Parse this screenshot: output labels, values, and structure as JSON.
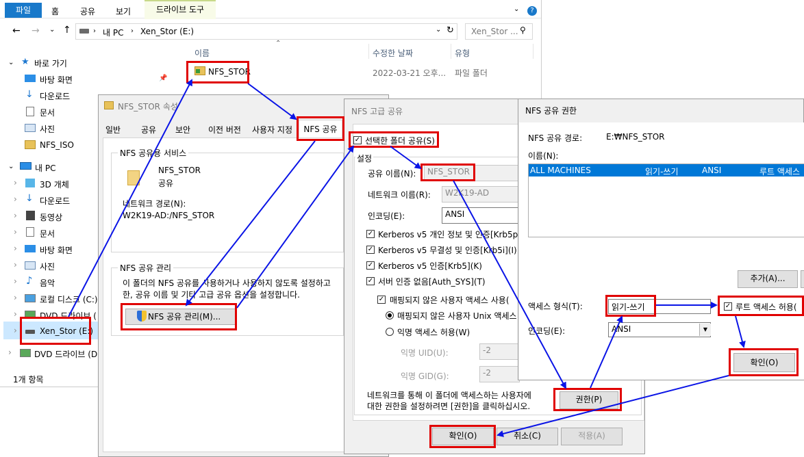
{
  "ribbon": {
    "tabs": [
      "파일",
      "홈",
      "공유",
      "보기",
      "드라이브 도구"
    ],
    "active_tab": "드라이브 도구"
  },
  "addressbar": {
    "crumbs": [
      "내 PC",
      "Xen_Stor (E:)"
    ],
    "search_placeholder": "Xen_Stor ..."
  },
  "columns": {
    "name": "이름",
    "date": "수정한 날짜",
    "type": "유형"
  },
  "file": {
    "name": "NFS_STOR",
    "date": "2022-03-21 오후...",
    "type": "파일 폴더"
  },
  "nav": {
    "quick_access": "바로 가기",
    "quick_items": [
      "바탕 화면",
      "다운로드",
      "문서",
      "사진",
      "NFS_ISO"
    ],
    "this_pc": "내 PC",
    "pc_items": [
      "3D 개체",
      "다운로드",
      "동영상",
      "문서",
      "바탕 화면",
      "사진",
      "음악",
      "로컬 디스크 (C:)",
      "DVD 드라이브 (",
      "Xen_Stor (E:)",
      "DVD 드라이브 (D"
    ]
  },
  "status": {
    "count": "1개 항목"
  },
  "props": {
    "title": "NFS_STOR 속성",
    "tabs": [
      "일반",
      "공유",
      "보안",
      "이전 버전",
      "사용자 지정",
      "NFS 공유"
    ],
    "service_header": "NFS 공유용 서비스",
    "folder_name": "NFS_STOR",
    "folder_sub": "공유",
    "network_path_label": "네트워크 경로(N):",
    "network_path": "W2K19-AD:/NFS_STOR",
    "manage_header": "NFS 공유 관리",
    "manage_desc_1": "이 폴더의 NFS 공유를 사용하거나 사용하지 않도록 설정하고",
    "manage_desc_2": "한, 공유 이름 및 기타 고급 공유 옵션을 설정합니다.",
    "manage_button": "NFS 공유 관리(M)..."
  },
  "advanced": {
    "title": "NFS 고급 공유",
    "share_checkbox": "선택한 폴더 공유(S)",
    "settings_header": "설정",
    "share_name_label": "공유 이름(N):",
    "share_name": "NFS_STOR",
    "network_name_label": "네트워크 이름(R):",
    "network_name": "W2K19-AD",
    "encoding_label": "인코딩(E):",
    "encoding": "ANSI",
    "krb5p": "Kerberos v5 개인 정보 및 인증[Krb5p](",
    "krb5i": "Kerberos v5 무결성 및 인증[Krb5i](I)",
    "krb5": "Kerberos v5 인증[Krb5](K)",
    "auth_sys": "서버 인증 없음[Auth_SYS](T)",
    "unmapped": "매핑되지 않은 사용자 액세스 사용(",
    "unmapped_unix": "매핑되지 않은 사용자 Unix 액세스",
    "anon": "익명 액세스 허용(W)",
    "anon_uid_label": "익명 UID(U):",
    "anon_uid": "-2",
    "anon_gid_label": "익명 GID(G):",
    "anon_gid": "-2",
    "perm_desc_1": "네트워크를 통해 이 폴더에 액세스하는 사용자에",
    "perm_desc_2": "대한 권한을 설정하려면 [권한]을 클릭하십시오.",
    "perm_button": "권한(P)",
    "ok": "확인(O)",
    "cancel": "취소(C)",
    "apply": "적용(A)"
  },
  "perm": {
    "title": "NFS 공유 권한",
    "path_label": "NFS 공유 경로:",
    "path": "E:₩NFS_STOR",
    "names_label": "이름(N):",
    "row": {
      "name": "ALL MACHINES",
      "access": "읽기-쓰기",
      "encoding": "ANSI",
      "root": "루트 액세스"
    },
    "add_button": "추가(A)...",
    "access_label": "액세스 형식(T):",
    "access_value": "읽기-쓰기",
    "root_checkbox": "루트 액세스 허용(",
    "encoding_label": "인코딩(E):",
    "encoding_value": "ANSI",
    "ok": "확인(O)"
  },
  "colors": {
    "highlight": "#e00000",
    "arrow": "#0a14e6",
    "accent": "#0078d7"
  }
}
